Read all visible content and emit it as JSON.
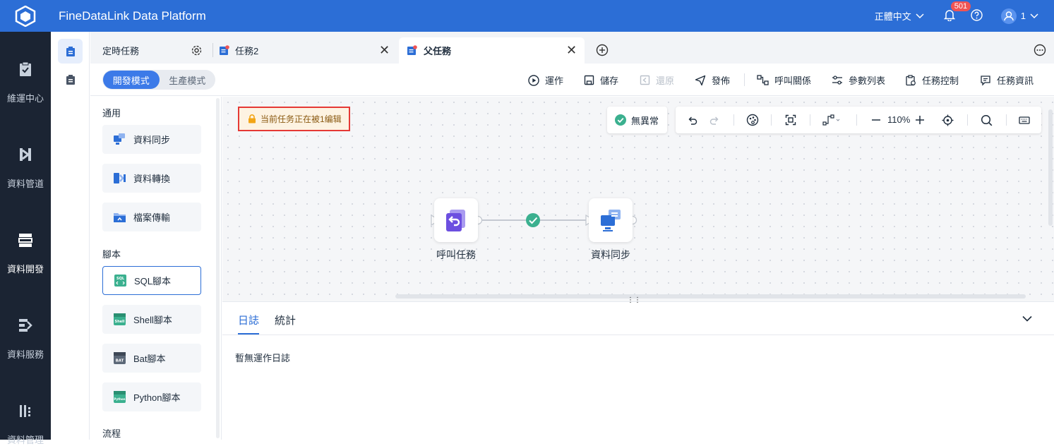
{
  "header": {
    "app_title": "FineDataLink Data Platform",
    "language": "正體中文",
    "notification_count": "501",
    "user_name": "1"
  },
  "left_nav": [
    {
      "label": "維運中心",
      "icon": "clipboard-check-icon"
    },
    {
      "label": "資料管道",
      "icon": "pipeline-icon"
    },
    {
      "label": "資料開發",
      "icon": "database-dev-icon",
      "active": true
    },
    {
      "label": "資料服務",
      "icon": "data-service-icon"
    },
    {
      "label": "資料管理",
      "icon": "data-manage-icon"
    }
  ],
  "tabs": {
    "scheduled": "定時任務",
    "task2": "任務2",
    "parent": "父任務"
  },
  "toolbar": {
    "mode_dev": "開發模式",
    "mode_prod": "生產模式",
    "run": "運作",
    "save": "儲存",
    "restore": "還原",
    "publish": "發佈",
    "call_relation": "呼叫關係",
    "param_list": "參數列表",
    "task_control": "任務控制",
    "task_info": "任務資訊"
  },
  "palette": {
    "general_title": "通用",
    "sync": "資料同步",
    "transform": "資料轉換",
    "file_transfer": "檔案傳輸",
    "script_title": "腳本",
    "sql": "SQL腳本",
    "shell": "Shell腳本",
    "bat": "Bat腳本",
    "python": "Python腳本",
    "flow_title": "流程"
  },
  "canvas": {
    "lock_note": "当前任务正在被1编辑",
    "status": "無異常",
    "zoom": "110%",
    "node_call": "呼叫任務",
    "node_sync": "資料同步"
  },
  "bottom": {
    "tab_log": "日誌",
    "tab_stats": "統計",
    "empty_log": "暫無運作日誌"
  },
  "colors": {
    "primary": "#2c6ed6",
    "nav_bg": "#1b2433",
    "success": "#3bb08f",
    "lock_border": "#e53935"
  }
}
